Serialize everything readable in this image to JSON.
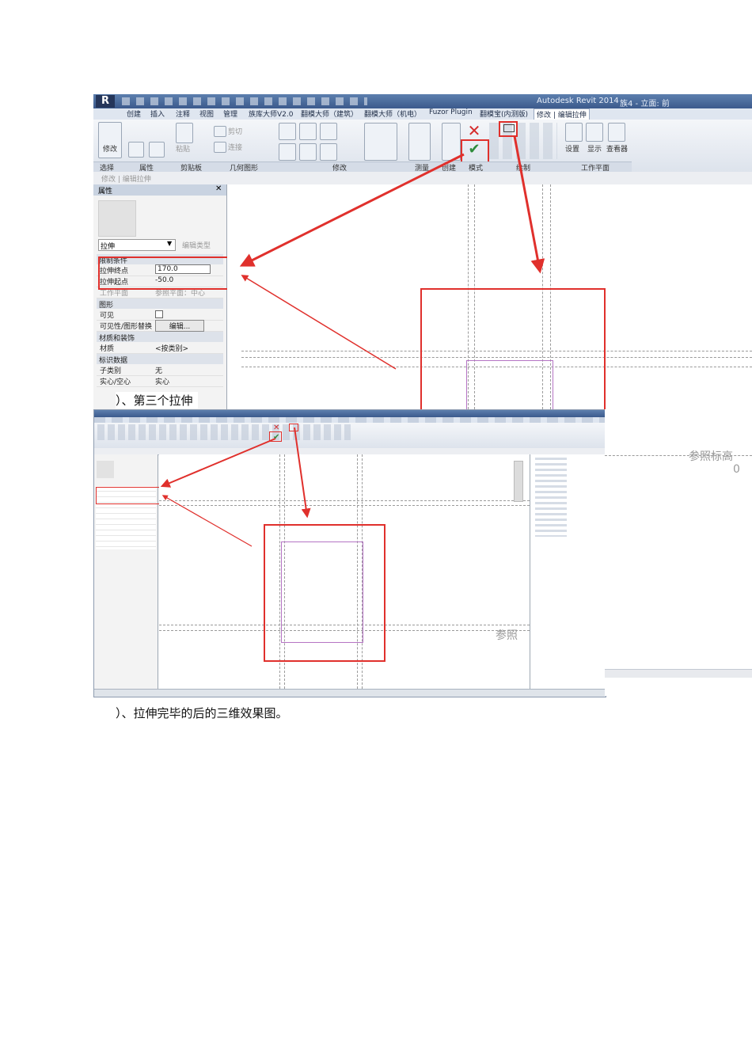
{
  "shot1": {
    "title_app": "Autodesk Revit 2014",
    "title_doc": "族4 - 立面: 前",
    "tabs": [
      "创建",
      "插入",
      "注释",
      "视图",
      "管理",
      "族库大师V2.0",
      "翻模大师（建筑）",
      "翻模大师（机电）",
      "Fuzor Plugin",
      "翻模宝(内测版)",
      "修改 | 编辑拉伸"
    ],
    "groups": [
      "选择",
      "属性",
      "剪贴板",
      "几何图形",
      "修改",
      "测量",
      "创建",
      "模式",
      "绘制",
      "工作平面"
    ],
    "tools": {
      "modify": "修改",
      "paste": "粘贴",
      "cut": "剪切",
      "join": "连接",
      "settings": "设置",
      "show": "显示",
      "viewer": "查看器"
    },
    "context_bar": "修改 | 编辑拉伸",
    "properties": {
      "title": "属性",
      "type": "拉伸",
      "edit_type": "编辑类型",
      "sections": {
        "constraints": "限制条件",
        "graphics": "图形",
        "materials": "材质和装饰",
        "identity": "标识数据"
      },
      "rows": {
        "extrusion_end_label": "拉伸终点",
        "extrusion_end_value": "170.0",
        "extrusion_start_label": "拉伸起点",
        "extrusion_start_value": "-50.0",
        "work_plane_label": "工作平面",
        "work_plane_value": "参照平面：中心",
        "visible_label": "可见",
        "vg_label": "可见性/图形替换",
        "vg_value": "编辑...",
        "material_label": "材质",
        "material_value": "<按类别>",
        "subcategory_label": "子类别",
        "subcategory_value": "无",
        "solid_label": "实心/空心",
        "solid_value": "实心"
      }
    }
  },
  "caption1": "）、第三个拉伸",
  "shot2": {
    "ref_level_label": "参照标高",
    "ref_level_value": "0",
    "ref_label_partial": "参照"
  },
  "caption2": "）、拉伸完毕的后的三维效果图。",
  "colors": {
    "highlight": "#e0302c",
    "sketch": "#b574c4"
  }
}
